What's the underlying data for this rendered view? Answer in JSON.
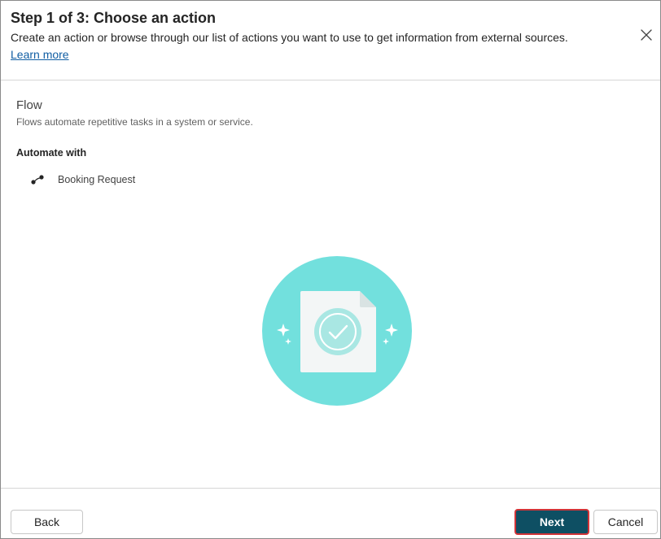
{
  "dialog": {
    "title": "Step 1 of 3: Choose an action",
    "subtitle": "Create an action or browse through our list of actions you want to use to get information from external sources.",
    "learn_more": "Learn more",
    "close_icon": "close-icon"
  },
  "section": {
    "title": "Flow",
    "description": "Flows automate repetitive tasks in a system or service.",
    "automate_label": "Automate with",
    "flow_item": {
      "icon": "flow-icon",
      "label": "Booking Request"
    }
  },
  "illustration": {
    "icon": "document-check-icon",
    "circle_color": "#72e0dd"
  },
  "footer": {
    "back_label": "Back",
    "next_label": "Next",
    "cancel_label": "Cancel"
  },
  "colors": {
    "primary": "#0e4f63",
    "highlight_border": "#d13438",
    "link": "#115ea3"
  }
}
